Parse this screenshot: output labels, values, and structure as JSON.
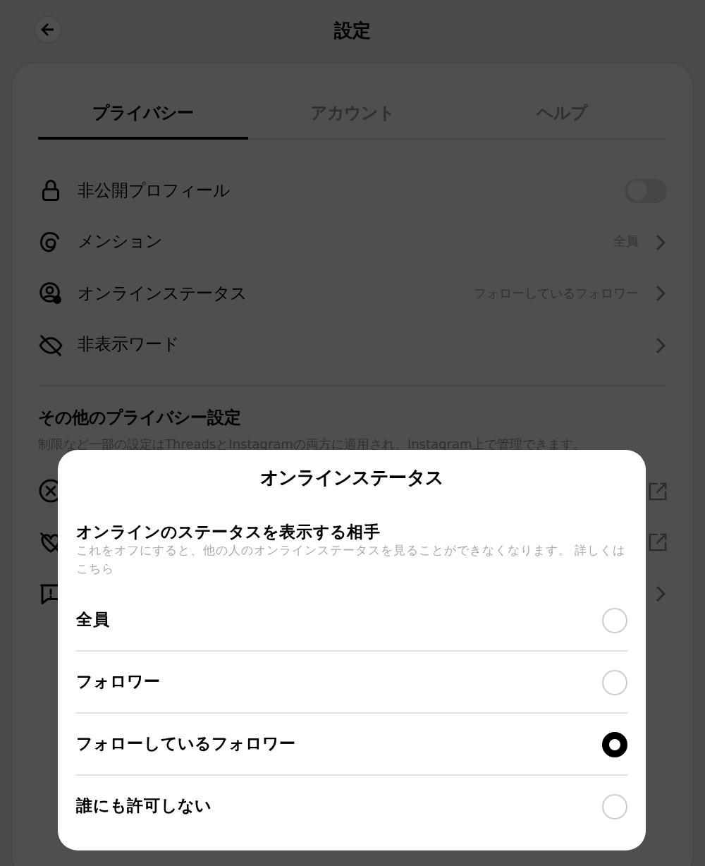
{
  "header": {
    "title": "設定"
  },
  "tabs": [
    {
      "label": "プライバシー",
      "selected": true
    },
    {
      "label": "アカウント",
      "selected": false
    },
    {
      "label": "ヘルプ",
      "selected": false
    }
  ],
  "settings": [
    {
      "kind": "toggle",
      "label": "非公開プロフィール",
      "on": false
    },
    {
      "kind": "link",
      "label": "メンション",
      "value": "全員"
    },
    {
      "kind": "link",
      "label": "オンラインステータス",
      "value": "フォローしているフォロワー"
    },
    {
      "kind": "link",
      "label": "非表示ワード"
    }
  ],
  "other_section": {
    "title": "その他のプライバシー設定",
    "subtitle": "制限など一部の設定はThreadsとInstagramの両方に適用され、Instagram上で管理できます。",
    "rows": [
      {
        "kind": "external"
      },
      {
        "kind": "external"
      },
      {
        "kind": "next"
      }
    ]
  },
  "dialog": {
    "title": "オンラインステータス",
    "heading": "オンラインのステータスを表示する相手",
    "description": "これをオフにすると、他の人のオンラインステータスを見ることができなくなります。 詳しくはこちら",
    "options": [
      {
        "label": "全員",
        "selected": false
      },
      {
        "label": "フォロワー",
        "selected": false
      },
      {
        "label": "フォローしているフォロワー",
        "selected": true
      },
      {
        "label": "誰にも許可しない",
        "selected": false
      }
    ]
  }
}
